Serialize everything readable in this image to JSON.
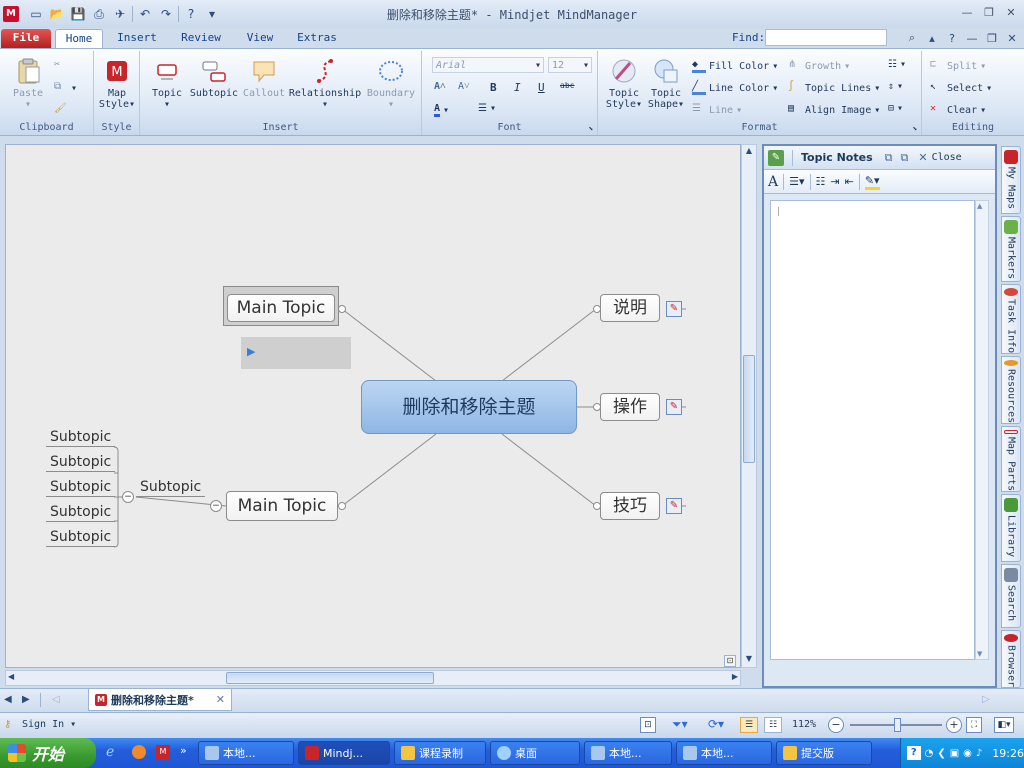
{
  "window": {
    "app_icon": "M",
    "title": "删除和移除主题* - Mindjet MindManager"
  },
  "tabs": {
    "file": "File",
    "home": "Home",
    "insert": "Insert",
    "review": "Review",
    "view": "View",
    "extras": "Extras",
    "find_label": "Find:"
  },
  "ribbon": {
    "clipboard": {
      "label": "Clipboard",
      "paste": "Paste"
    },
    "style": {
      "label": "Style",
      "map_style": "Map",
      "map_style2": "Style"
    },
    "insert": {
      "label": "Insert",
      "topic": "Topic",
      "subtopic": "Subtopic",
      "callout": "Callout",
      "relationship": "Relationship",
      "boundary": "Boundary"
    },
    "font": {
      "label": "Font",
      "font_name": "Arial",
      "font_size": "12",
      "bold": "B",
      "italic": "I",
      "underline": "U",
      "strike": "abc"
    },
    "format": {
      "label": "Format",
      "topic_style": "Topic",
      "topic_style2": "Style",
      "topic_shape": "Topic",
      "topic_shape2": "Shape",
      "fill_color": "Fill Color",
      "line_color": "Line Color",
      "line": "Line",
      "growth": "Growth",
      "topic_lines": "Topic Lines",
      "align_image": "Align Image"
    },
    "editing": {
      "label": "Editing",
      "split": "Split",
      "select": "Select",
      "clear": "Clear"
    }
  },
  "map": {
    "central": "删除和移除主题",
    "main_topic_top": "Main Topic",
    "main_topic_bottom": "Main Topic",
    "subtopic_mid": "Subtopic",
    "subtopics": [
      "Subtopic",
      "Subtopic",
      "Subtopic",
      "Subtopic",
      "Subtopic"
    ],
    "right_topics": [
      "说明",
      "操作",
      "技巧"
    ]
  },
  "notes": {
    "title": "Topic Notes",
    "close": "Close"
  },
  "side_tabs": [
    "My Maps",
    "Markers",
    "Task Info",
    "Resources",
    "Map Parts",
    "Library",
    "Search",
    "Browser"
  ],
  "doc_tab": "删除和移除主题*",
  "status": {
    "sign_in": "Sign In",
    "zoom": "112%"
  },
  "taskbar": {
    "start": "开始",
    "tasks": [
      "本地...",
      "Mindj...",
      "课程录制",
      "桌面",
      "本地...",
      "本地...",
      "提交版"
    ],
    "clock": "19:26"
  },
  "colors": {
    "central_fill": "#9fc3ea",
    "file_tab": "#c8252a",
    "taskbar": "#245edb",
    "start": "#3a9a30"
  }
}
